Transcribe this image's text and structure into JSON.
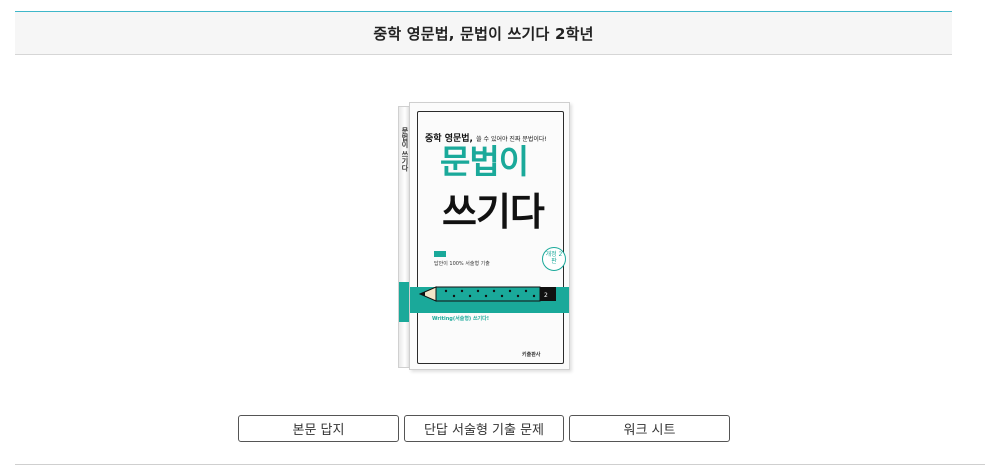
{
  "header": {
    "title": "중학 영문법, 문법이 쓰기다 2학년"
  },
  "book_cover": {
    "tagline": "중학 영문법,",
    "tagline_small": "쓸 수 있어야 진짜 문법이다!",
    "title_line1": "문법이",
    "title_line2": "쓰기다",
    "sticker": "개정 2판",
    "spine_title": "문법이 쓰기다",
    "blurb": "답안이 100% 서술형 기출",
    "publisher": "키출판사",
    "bottom_left": "Writing(서술형) 쓰기다!",
    "accent_color": "#1aa99a"
  },
  "buttons": [
    {
      "label": "본문 답지"
    },
    {
      "label": "단답 서술형 기출 문제"
    },
    {
      "label": "워크 시트"
    }
  ]
}
